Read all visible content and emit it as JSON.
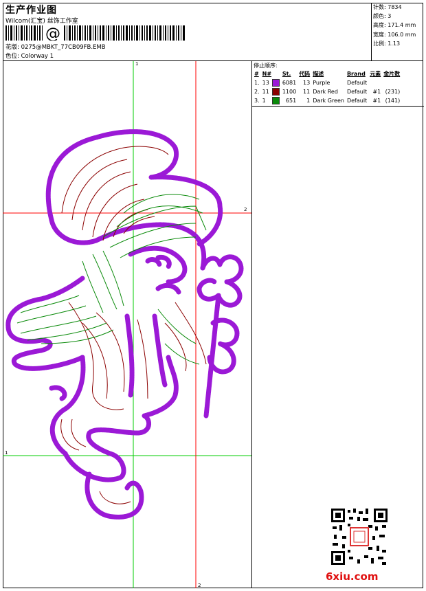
{
  "header": {
    "title": "生产作业图",
    "company": "Wilcom(汇宝) 丝饰工作室",
    "barcode_char": "@",
    "design_file_label": "花版:",
    "design_file": "0275@MBKT_77CB09FB.EMB",
    "colorway_label": "色位:",
    "colorway": "Colorway 1"
  },
  "stats": [
    {
      "label": "针数:",
      "value": "7834"
    },
    {
      "label": "颜色:",
      "value": "3"
    },
    {
      "label": "高度:",
      "value": "171.4 mm"
    },
    {
      "label": "宽度:",
      "value": "106.0 mm"
    },
    {
      "label": "比例:",
      "value": "1.13"
    }
  ],
  "stop_sequence": {
    "title": "停止顺序:",
    "headers": [
      "#",
      "N#",
      "St.",
      "代码",
      "描述",
      "Brand",
      "元素",
      "金片数"
    ],
    "rows": [
      {
        "index": "1.",
        "needle": "13",
        "color": "#9b19d6",
        "stitches": "6081",
        "code": "13",
        "desc": "Purple",
        "brand": "Default",
        "element": "",
        "sequins": ""
      },
      {
        "index": "2.",
        "needle": "11",
        "color": "#8b0000",
        "stitches": "1100",
        "code": "11",
        "desc": "Dark Red",
        "brand": "Default",
        "element": "#1",
        "sequins": "(231)"
      },
      {
        "index": "3.",
        "needle": "1",
        "color": "#0a8a0a",
        "stitches": "651",
        "code": "1",
        "desc": "Dark Green",
        "brand": "Default",
        "element": "#1",
        "sequins": "(141)"
      }
    ]
  },
  "guides": {
    "v1": "1",
    "h2": "2",
    "h1": "1",
    "v2": "2"
  },
  "colors": {
    "purple": "#9b19d6",
    "dark_red": "#8b0000",
    "green": "#0a8a0a",
    "guide_green": "#00cc00",
    "guide_red": "#ff0000"
  },
  "watermark": "6xiu.com"
}
